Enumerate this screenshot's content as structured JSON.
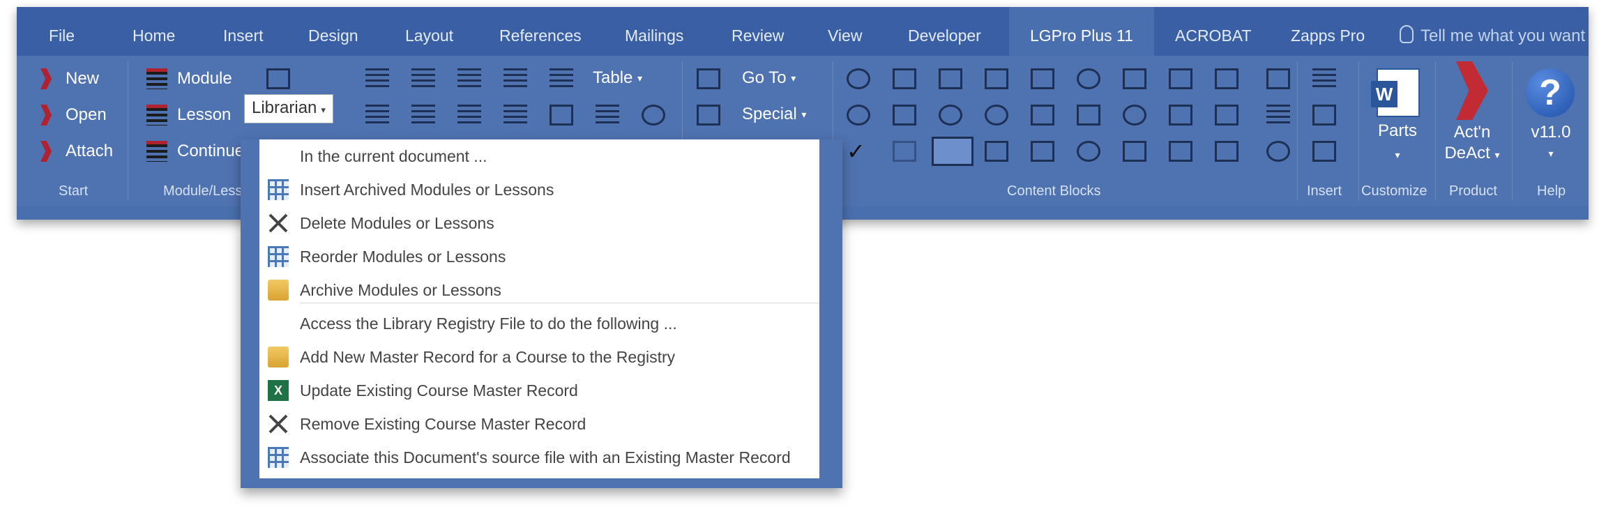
{
  "tabs": [
    {
      "label": "File"
    },
    {
      "label": "Home"
    },
    {
      "label": "Insert"
    },
    {
      "label": "Design"
    },
    {
      "label": "Layout"
    },
    {
      "label": "References"
    },
    {
      "label": "Mailings"
    },
    {
      "label": "Review"
    },
    {
      "label": "View"
    },
    {
      "label": "Developer"
    },
    {
      "label": "LGPro Plus 11"
    },
    {
      "label": "ACROBAT"
    },
    {
      "label": "Zapps Pro"
    }
  ],
  "tell_me": "Tell me what you want",
  "groups": {
    "start": {
      "label": "Start",
      "buttons": [
        "New",
        "Open",
        "Attach"
      ]
    },
    "module_lesson": {
      "label": "Module/Lesson",
      "buttons": [
        "Module",
        "Lesson",
        "Continue"
      ],
      "librarian": "Librarian"
    },
    "table": "Table",
    "goto": "Go To",
    "special": "Special",
    "content_blocks": {
      "label": "Content Blocks"
    },
    "insert": {
      "label": "Insert"
    },
    "customize": {
      "label": "Customize",
      "parts": "Parts"
    },
    "product": {
      "label": "Product",
      "actn_line1": "Act'n",
      "actn_line2": "DeAct"
    },
    "help": {
      "label": "Help",
      "version": "v11.0"
    }
  },
  "menu": {
    "header1": "In the current document ...",
    "items1": [
      {
        "label": "Insert Archived Modules or Lessons",
        "icon": "insert-archive-icon"
      },
      {
        "label": "Delete Modules or Lessons",
        "icon": "delete-x-icon"
      },
      {
        "label": "Reorder Modules or Lessons",
        "icon": "reorder-icon"
      },
      {
        "label": "Archive Modules or Lessons",
        "icon": "archive-icon"
      }
    ],
    "header2": "Access the Library Registry File to do the following ...",
    "items2": [
      {
        "label": "Add New Master Record for a Course to the Registry",
        "icon": "add-record-icon"
      },
      {
        "label": "Update Existing Course Master Record",
        "icon": "excel-update-icon"
      },
      {
        "label": "Remove Existing Course Master Record",
        "icon": "remove-x-icon"
      },
      {
        "label": "Associate this Document's source file with an Existing Master Record",
        "icon": "associate-link-icon"
      }
    ]
  },
  "colors": {
    "ribbon": "#4a6fae",
    "tabbar": "#3a5fa4",
    "accent_red": "#b02230"
  }
}
